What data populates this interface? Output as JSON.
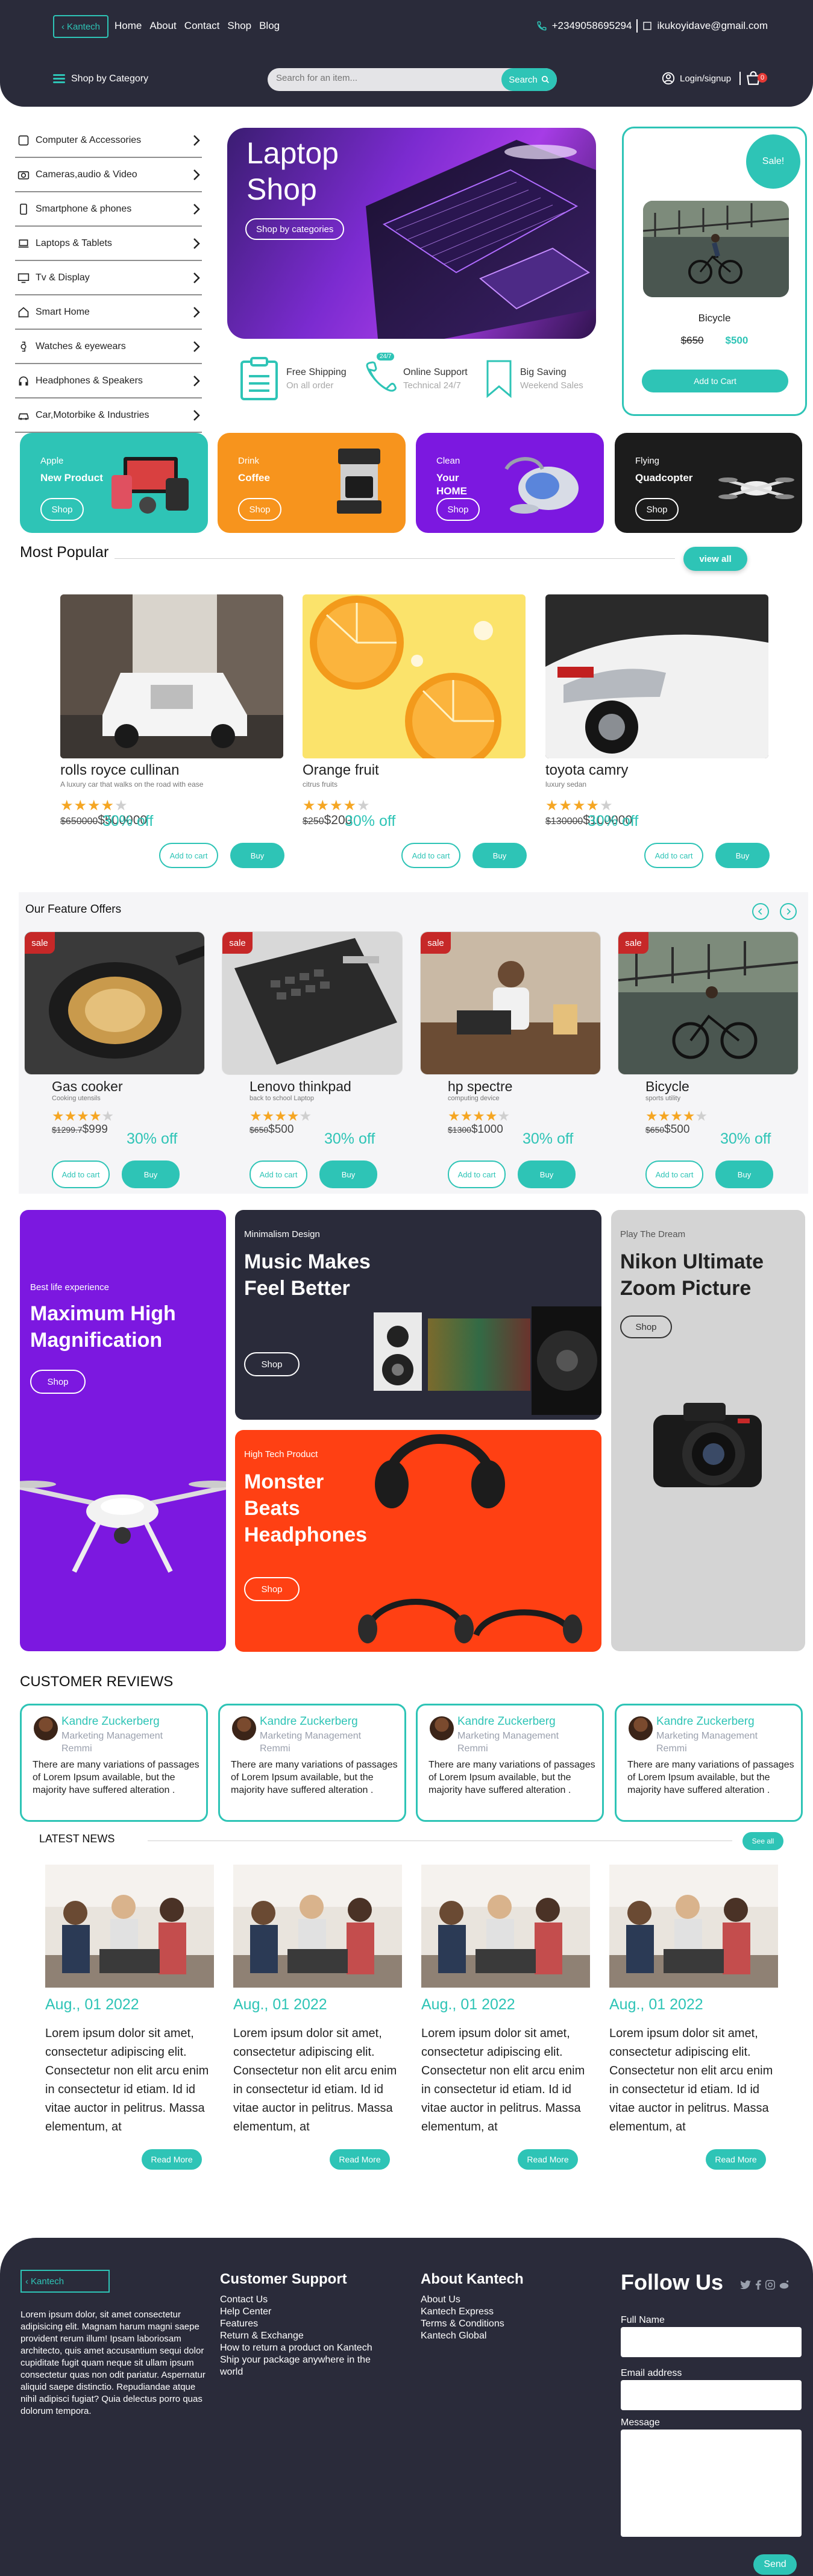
{
  "colors": {
    "accent": "#2ec4b6",
    "dark": "#2a2b3a",
    "sale_red": "#c62828",
    "star": "#f5a623"
  },
  "header": {
    "logo": "Kantech",
    "nav": [
      "Home",
      "About",
      "Contact",
      "Shop",
      "Blog"
    ],
    "phone": "+2349058695294",
    "email": "ikukoyidave@gmail.com",
    "category_label": "Shop by Category",
    "search_placeholder": "Search for an item...",
    "search_button": "Search",
    "login": "Login/signup",
    "cart_count": "0"
  },
  "sidebar": {
    "items": [
      {
        "label": "Computer & Accessories",
        "icon": "monitor-icon"
      },
      {
        "label": "Cameras,audio & Video",
        "icon": "camera-icon"
      },
      {
        "label": "Smartphone & phones",
        "icon": "smartphone-icon"
      },
      {
        "label": "Laptops & Tablets",
        "icon": "laptop-icon"
      },
      {
        "label": "Tv & Display",
        "icon": "tv-icon"
      },
      {
        "label": "Smart Home",
        "icon": "home-icon"
      },
      {
        "label": "Watches & eyewears",
        "icon": "watch-icon"
      },
      {
        "label": "Headphones & Speakers",
        "icon": "headphones-icon"
      },
      {
        "label": "Car,Motorbike & Industries",
        "icon": "car-icon"
      }
    ]
  },
  "hero": {
    "title_line1": "Laptop",
    "title_line2": "Shop",
    "button": "Shop by categories"
  },
  "features": [
    {
      "title": "Free Shipping",
      "subtitle": "On all order",
      "icon": "clipboard-icon"
    },
    {
      "title": "Online Support",
      "subtitle": "Technical 24/7",
      "icon": "phone-icon",
      "badge": "24/7"
    },
    {
      "title": "Big Saving",
      "subtitle": "Weekend Sales",
      "icon": "bookmark-icon"
    }
  ],
  "sale_card": {
    "badge": "Sale!",
    "name": "Bicycle",
    "old_price": "$650",
    "price": "$500",
    "button": "Add to Cart"
  },
  "promos": [
    {
      "small": "Apple",
      "big": "New Product",
      "button": "Shop",
      "bg": "#2ec4b6"
    },
    {
      "small": "Drink",
      "big": "Coffee",
      "button": "Shop",
      "bg": "#f7941d"
    },
    {
      "small": "Clean",
      "big": "Your HOME",
      "button": "Shop",
      "bg": "#7c18e0"
    },
    {
      "small": "Flying",
      "big": "Quadcopter",
      "button": "Shop",
      "bg": "#1c1c1c"
    }
  ],
  "most_popular": {
    "title": "Most Popular",
    "view_all": "view all",
    "items": [
      {
        "name": "rolls royce cullinan",
        "desc": "A luxury car that walks on the road with ease",
        "rating": 4,
        "old_price": "$650000",
        "price": "$500000",
        "off": "30% off"
      },
      {
        "name": "Orange fruit",
        "desc": "citrus fruits",
        "rating": 4,
        "old_price": "$250",
        "price": "$200",
        "off": "30% off"
      },
      {
        "name": "toyota camry",
        "desc": "luxury sedan",
        "rating": 4,
        "old_price": "$130000",
        "price": "$100000",
        "off": "30% off"
      }
    ],
    "add_to_cart": "Add to cart",
    "buy": "Buy"
  },
  "feature_offers": {
    "title": "Our Feature Offers",
    "sale": "sale",
    "items": [
      {
        "name": "Gas cooker",
        "desc": "Cooking utensils",
        "rating": 4,
        "old_price": "$1299.7",
        "price": "$999",
        "off": "30% off"
      },
      {
        "name": "Lenovo thinkpad",
        "desc": "back to school Laptop",
        "rating": 4,
        "old_price": "$650",
        "price": "$500",
        "off": "30% off"
      },
      {
        "name": "hp spectre",
        "desc": "computing device",
        "rating": 4,
        "old_price": "$1300",
        "price": "$1000",
        "off": "30% off"
      },
      {
        "name": "Bicycle",
        "desc": "sports utility",
        "rating": 4,
        "old_price": "$650",
        "price": "$500",
        "off": "30% off"
      }
    ],
    "add_to_cart": "Add to cart",
    "buy": "Buy"
  },
  "big_promos": {
    "drone": {
      "small": "Best life experience",
      "big": "Maximum High Magnification",
      "button": "Shop"
    },
    "music": {
      "small": "Minimalism Design",
      "big": "Music Makes Feel Better",
      "button": "Shop"
    },
    "headphones": {
      "small": "High Tech Product",
      "big": "Monster Beats Headphones",
      "button": "Shop"
    },
    "camera": {
      "small": "Play The Dream",
      "big": "Nikon Ultimate Zoom Picture",
      "button": "Shop"
    }
  },
  "reviews": {
    "title": "CUSTOMER REVIEWS",
    "items": [
      {
        "name": "Kandre Zuckerberg",
        "role": "Marketing Management Remmi",
        "text": "There are many variations of passages of Lorem Ipsum available, but the majority have suffered alteration ."
      },
      {
        "name": "Kandre Zuckerberg",
        "role": "Marketing Management Remmi",
        "text": "There are many variations of passages of Lorem Ipsum available, but the majority have suffered alteration ."
      },
      {
        "name": "Kandre Zuckerberg",
        "role": "Marketing Management Remmi",
        "text": "There are many variations of passages of Lorem Ipsum available, but the majority have suffered alteration ."
      },
      {
        "name": "Kandre Zuckerberg",
        "role": "Marketing Management Remmi",
        "text": "There are many variations of passages of Lorem Ipsum available, but the majority have suffered alteration ."
      }
    ]
  },
  "news": {
    "title": "LATEST NEWS",
    "see_all": "See all",
    "items": [
      {
        "date": "Aug., 01 2022",
        "text": "Lorem ipsum dolor sit amet, consectetur adipiscing elit. Consectetur non elit arcu enim in consectetur id etiam. Id id vitae auctor in pelitrus. Massa elementum, at",
        "button": "Read More"
      },
      {
        "date": "Aug., 01 2022",
        "text": "Lorem ipsum dolor sit amet, consectetur adipiscing elit. Consectetur non elit arcu enim in consectetur id etiam. Id id vitae auctor in pelitrus. Massa elementum, at",
        "button": "Read More"
      },
      {
        "date": "Aug., 01 2022",
        "text": "Lorem ipsum dolor sit amet, consectetur adipiscing elit. Consectetur non elit arcu enim in consectetur id etiam. Id id vitae auctor in pelitrus. Massa elementum, at",
        "button": "Read More"
      },
      {
        "date": "Aug., 01 2022",
        "text": "Lorem ipsum dolor sit amet, consectetur adipiscing elit. Consectetur non elit arcu enim in consectetur id etiam. Id id vitae auctor in pelitrus. Massa elementum, at",
        "button": "Read More"
      }
    ]
  },
  "footer": {
    "logo": "Kantech",
    "about": "Lorem ipsum dolor, sit amet consectetur adipisicing elit. Magnam harum magni saepe provident rerum illum! Ipsam laboriosam architecto, quis amet accusantium sequi dolor cupiditate fugit quam neque sit ullam ipsum consectetur quas non odit pariatur. Aspernatur aliquid saepe distinctio. Repudiandae atque nihil adipisci fugiat? Quia delectus porro quas dolorum tempora.",
    "support_title": "Customer Support",
    "support_links": [
      "Contact Us",
      "Help Center",
      "Features",
      "Return & Exchange",
      "How to return a product on Kantech",
      "Ship your package anywhere in the world"
    ],
    "about_title": "About Kantech",
    "about_links": [
      "About Us",
      "Kantech Express",
      "Terms & Conditions",
      "Kantech Global"
    ],
    "follow_title": "Follow Us",
    "full_name_label": "Full Name",
    "email_label": "Email address",
    "message_label": "Message",
    "send": "Send"
  }
}
